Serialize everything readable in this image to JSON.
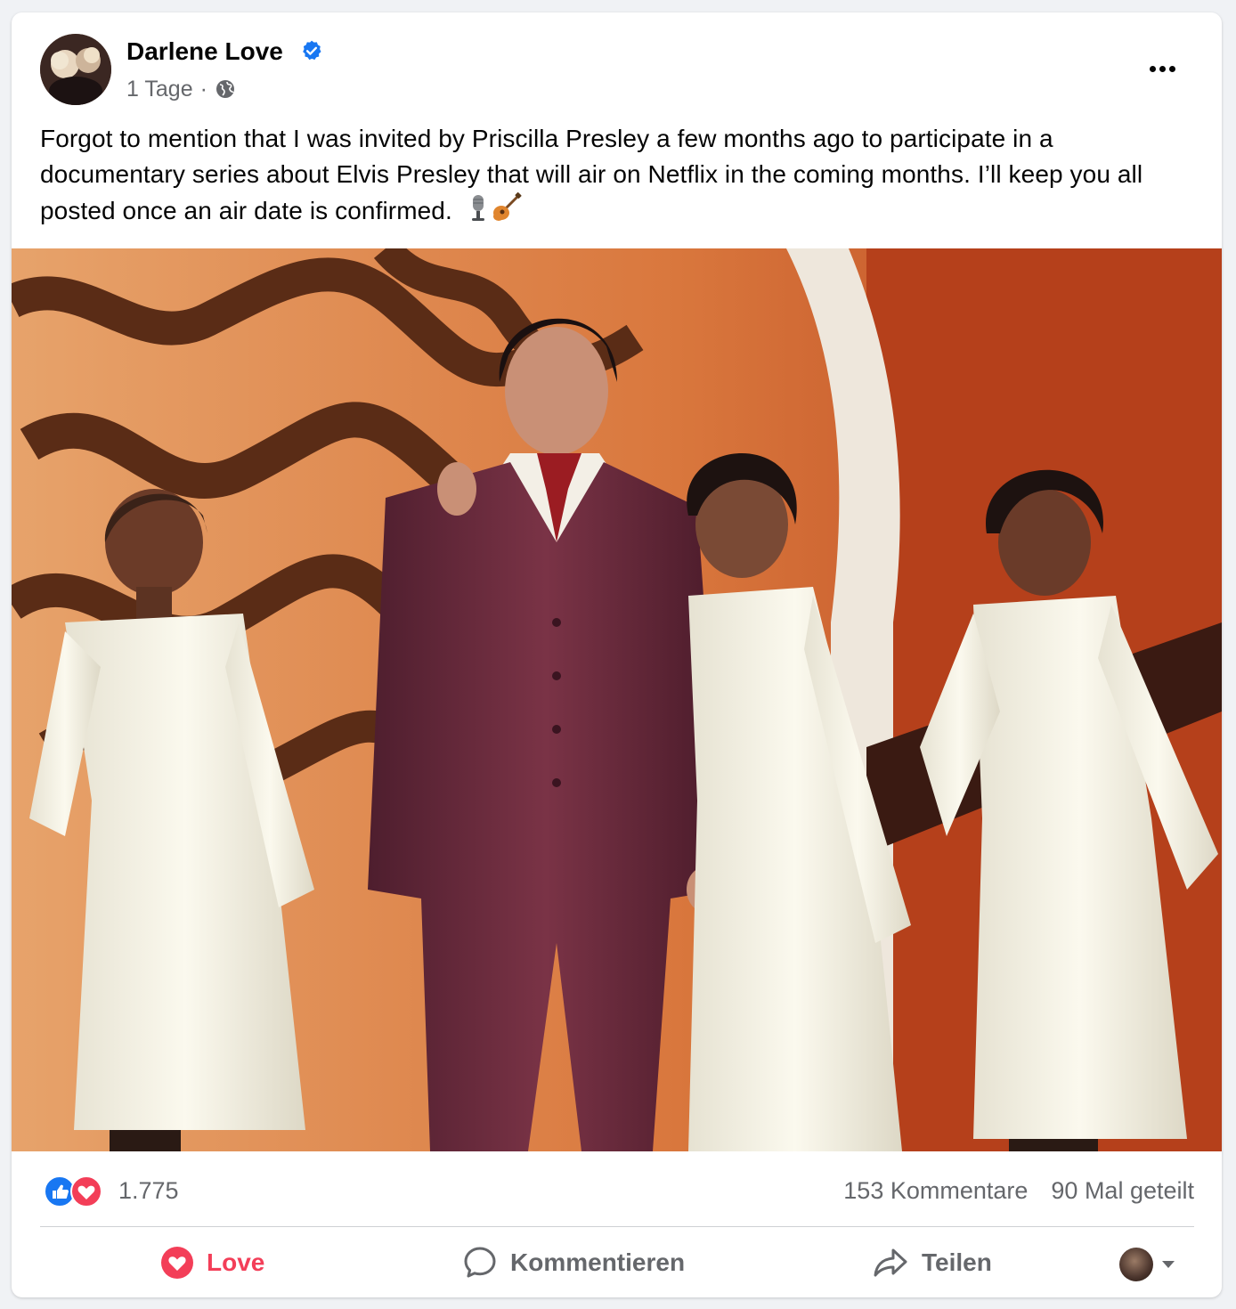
{
  "post": {
    "author": "Darlene Love",
    "time": "1 Tage",
    "separator": "·",
    "text": "Forgot to mention that I was invited by Priscilla Presley a few months ago to participate in a documentary series about Elvis Presley that will air on Netflix in the coming months. I’ll keep you all posted once an air date is confirmed.",
    "emojis": [
      "microphone",
      "guitar"
    ],
    "image": "Elvis Presley in a burgundy suit standing on stage with three women in white dresses in front of an orange swirl backdrop"
  },
  "stats": {
    "reactions_count": "1.775",
    "comments": "153 Kommentare",
    "shares": "90 Mal geteilt"
  },
  "actions": {
    "love": "Love",
    "comment": "Kommentieren",
    "share": "Teilen"
  },
  "colors": {
    "love": "#f33e58",
    "like": "#1877f2",
    "secondary_text": "#65676b",
    "verified": "#1877f2"
  }
}
